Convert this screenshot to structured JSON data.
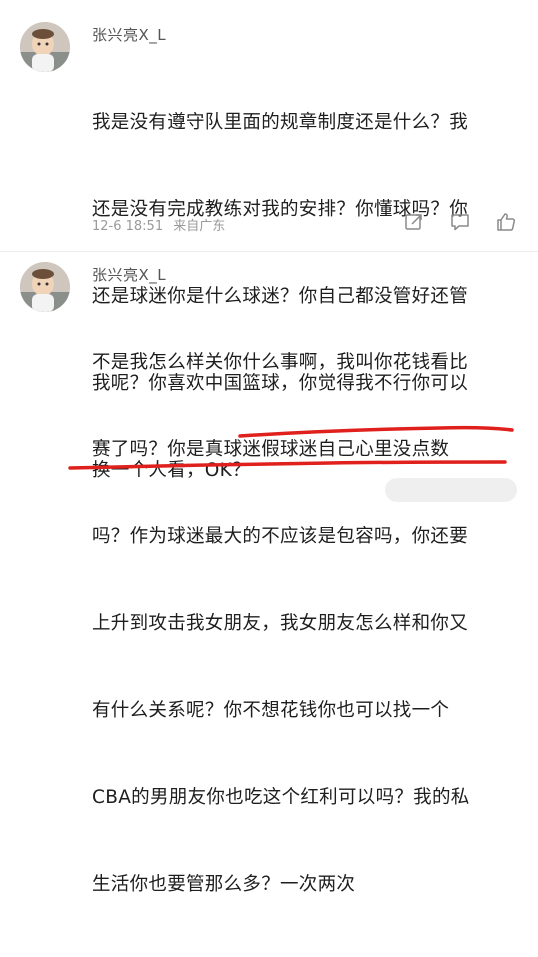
{
  "comments": [
    {
      "username": "张兴亮X_L",
      "lines": [
        "我是没有遵守队里面的规章制度还是什么？我",
        "还是没有完成教练对我的安排？你懂球吗？你",
        "还是球迷你是什么球迷？你自己都没管好还管",
        "我呢？你喜欢中国篮球，你觉得我不行你可以",
        "换一个人看，OK？"
      ],
      "date": "12-6 18:51",
      "location": "来自广东"
    },
    {
      "username": "张兴亮X_L",
      "lines": [
        "不是我怎么样关你什么事啊，我叫你花钱看比",
        "赛了吗？你是真球迷假球迷自己心里没点数",
        "吗？作为球迷最大的不应该是包容吗，你还要",
        "上升到攻击我女朋友，我女朋友怎么样和你又",
        "有什么关系呢？你不想花钱你也可以找一个",
        "CBA的男朋友你也吃这个红利可以吗？我的私",
        "生活你也要管那么多？一次两次"
      ]
    }
  ],
  "icons": [
    "share-icon",
    "comment-icon",
    "like-icon"
  ],
  "colors": {
    "underline": "#e0201c",
    "text": "#1e1e1e",
    "meta": "#9a9a9a"
  }
}
